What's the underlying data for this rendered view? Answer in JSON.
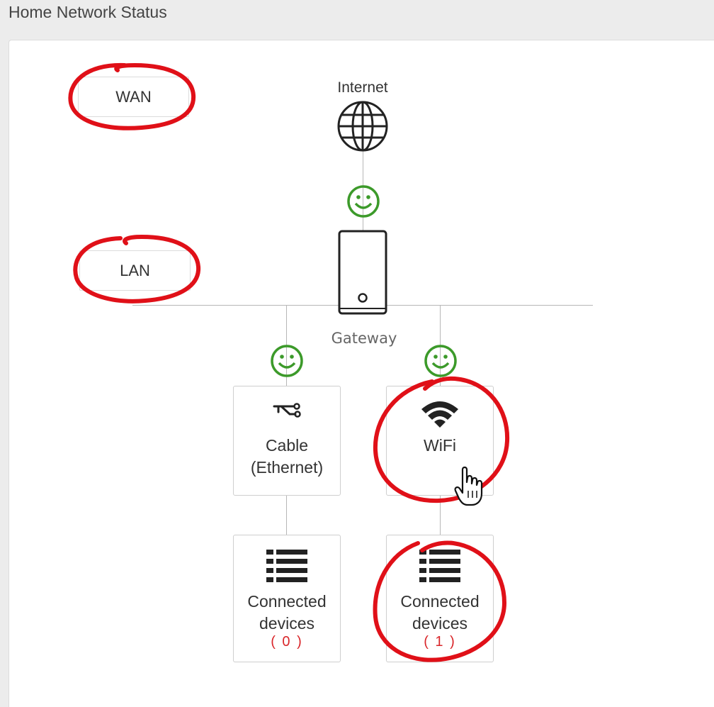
{
  "page": {
    "title": "Home Network Status"
  },
  "tabs": {
    "wan_label": "WAN",
    "lan_label": "LAN"
  },
  "diagram": {
    "internet_label": "Internet",
    "gateway_label": "Gateway",
    "status_color": "#3c9a2a",
    "highlight_color": "#e01018",
    "link_status": {
      "internet": "ok",
      "ethernet": "ok",
      "wifi": "ok"
    }
  },
  "tiles": {
    "ethernet": {
      "line1": "Cable",
      "line2": "(Ethernet)",
      "icon": "cable-icon"
    },
    "wifi": {
      "line1": "WiFi",
      "icon": "wifi-icon"
    },
    "ethernet_devices": {
      "line1": "Connected",
      "line2": "devices",
      "count": "( 0 )",
      "icon": "list-icon"
    },
    "wifi_devices": {
      "line1": "Connected",
      "line2": "devices",
      "count": "( 1 )",
      "icon": "list-icon"
    }
  }
}
